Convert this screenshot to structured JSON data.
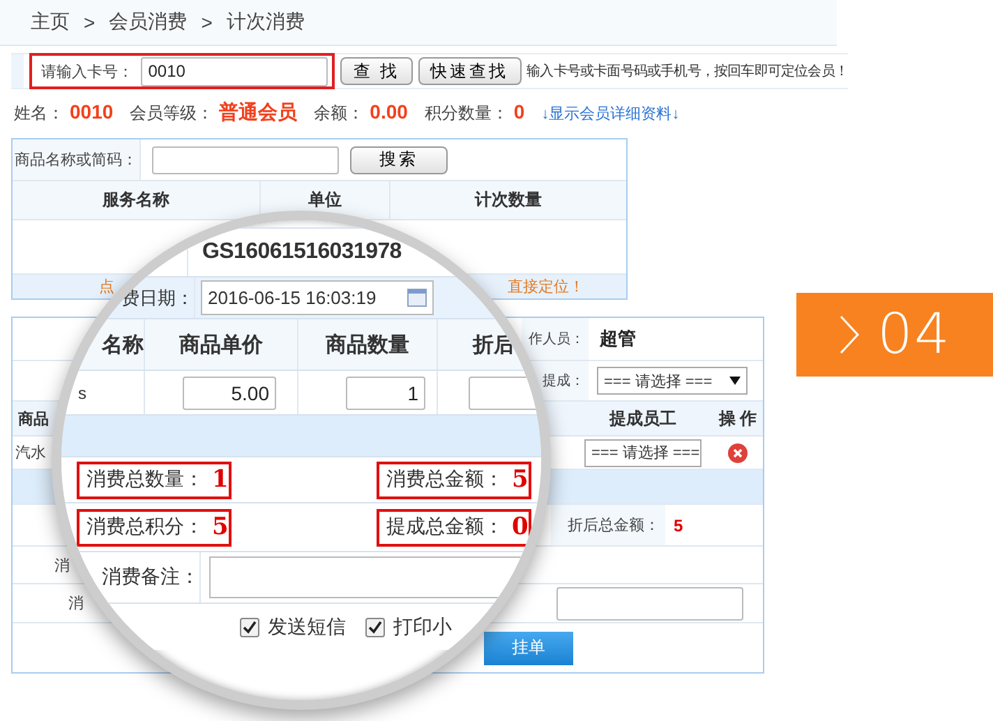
{
  "breadcrumb": [
    "主页",
    ">",
    "会员消费",
    ">",
    "计次消费"
  ],
  "card_search": {
    "label": "请输入卡号：",
    "value": "0010",
    "buttons": [
      "查 找",
      "快速查找"
    ],
    "hint": "输入卡号或卡面号码或手机号，按回车即可定位会员！"
  },
  "member": [
    {
      "label": "姓名：",
      "value": "0010"
    },
    {
      "label": "会员等级：",
      "value": "普通会员"
    },
    {
      "label": "余额：",
      "value": "0.00"
    },
    {
      "label": "积分数量：",
      "value": "0"
    }
  ],
  "member_link": "↓显示会员详细资料↓",
  "service_panel": {
    "search_label": "商品名称或简码：",
    "search_button": "搜索",
    "columns": [
      "服务名称",
      "单位",
      "计次数量"
    ],
    "hint_start": "点",
    "hint_end": "直接定位！"
  },
  "order_panel": {
    "operator_label": "作人员：",
    "operator": "超管",
    "commission_label": "提成：",
    "commission_select": "=== 请选择 ===",
    "columns": [
      "商品",
      "提成员工",
      "操 作"
    ],
    "row": {
      "name": "汽水",
      "staff_select": "=== 请选择 ==="
    },
    "discount_total_label": "折后总金额：",
    "discount_total": "5",
    "row_labels": [
      "消",
      "消"
    ],
    "submit_button": "挂单"
  },
  "badge": {
    "number": "04"
  },
  "magnifier": {
    "order_no": "GS16061516031978",
    "date_label": "费日期：",
    "date": "2016-06-15 16:03:19",
    "columns": [
      "名称",
      "商品单价",
      "商品数量",
      "折后"
    ],
    "item": {
      "name": "s",
      "price": "5.00",
      "quantity": "1"
    },
    "totals": [
      {
        "label": "消费总数量：",
        "value": "1"
      },
      {
        "label": "消费总金额：",
        "value": "5"
      },
      {
        "label": "消费总积分：",
        "value": "5"
      },
      {
        "label": "提成总金额：",
        "value": "0"
      }
    ],
    "note_label": "消费备注：",
    "options": [
      {
        "label": "发送短信",
        "checked": true
      },
      {
        "label": "打印小",
        "checked": true
      }
    ]
  }
}
